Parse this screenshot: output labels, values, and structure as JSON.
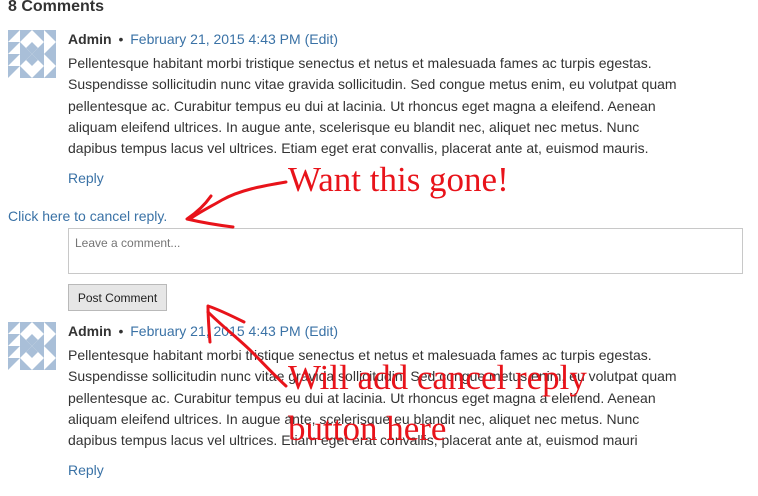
{
  "comments_heading": "8 Comments",
  "comments": [
    {
      "author": "Admin",
      "separator": "•",
      "date": "February 21, 2015 4:43 PM",
      "edit_label": "(Edit)",
      "lines": [
        "Pellentesque habitant morbi tristique senectus et netus et malesuada fames ac turpis egestas.",
        "Suspendisse sollicitudin nunc vitae gravida sollicitudin. Sed congue metus enim, eu volutpat quam",
        "pellentesque ac. Curabitur tempus eu dui at lacinia. Ut rhoncus eget magna a eleifend. Aenean",
        "aliquam eleifend ultrices. In augue ante, scelerisque eu blandit nec, aliquet nec metus. Nunc",
        "dapibus tempus lacus vel ultrices. Etiam eget erat convallis, placerat ante at, euismod mauris."
      ],
      "reply_label": "Reply"
    },
    {
      "author": "Admin",
      "separator": "•",
      "date": "February 21, 2015 4:43 PM",
      "edit_label": "(Edit)",
      "lines": [
        "Pellentesque habitant morbi tristique senectus et netus et malesuada fames ac turpis egestas.",
        "Suspendisse sollicitudin nunc vitae gravida sollicitudin. Sed congue metus enim, eu volutpat quam",
        "pellentesque ac. Curabitur tempus eu dui at lacinia. Ut rhoncus eget magna a eleifend. Aenean",
        "aliquam eleifend ultrices. In augue ante, scelerisque eu blandit nec, aliquet nec metus. Nunc",
        "dapibus tempus lacus vel ultrices. Etiam eget erat convallis, placerat ante at, euismod mauri"
      ],
      "reply_label": "Reply"
    }
  ],
  "reply_form": {
    "cancel_label": "Click here to cancel reply.",
    "textarea_value": "",
    "textarea_placeholder": "Leave a comment...",
    "submit_label": "Post Comment"
  },
  "annotations": {
    "top": "Want this gone!",
    "bottom_line1": "Will add cancel reply",
    "bottom_line2": "button here"
  },
  "colors": {
    "link": "#3a72a6",
    "annotation": "#e8131a",
    "avatar": "#a9bfd8"
  },
  "icons": {
    "avatar": "identicon-avatar-icon"
  }
}
